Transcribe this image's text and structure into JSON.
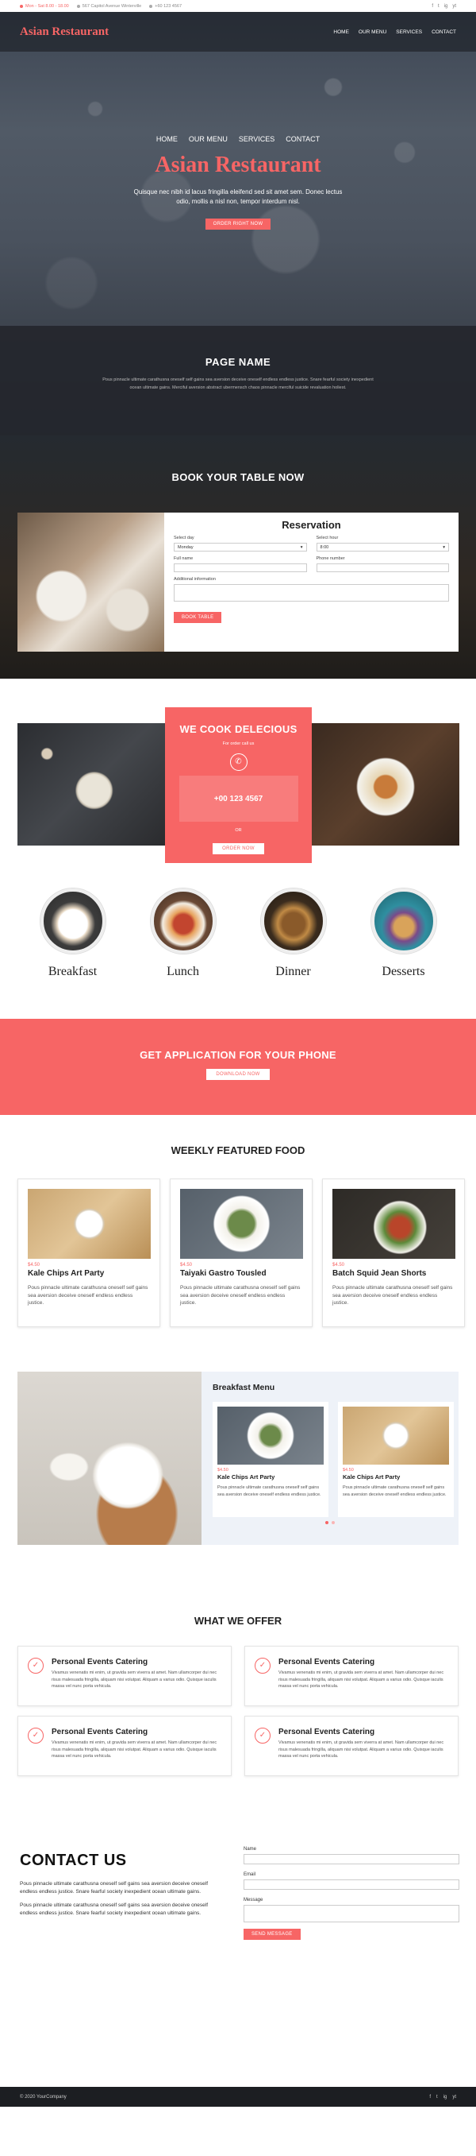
{
  "topbar": {
    "hours": "Mon - Sat 8.00 - 18.00",
    "address": "567 Capitol Avenue Winterville",
    "phone": "+60 123 4567",
    "social": [
      "f",
      "t",
      "ig",
      "yt"
    ]
  },
  "header": {
    "logo": "Asian Restaurant",
    "nav": [
      "HOME",
      "OUR MENU",
      "SERVICES",
      "CONTACT"
    ]
  },
  "hero": {
    "nav": [
      "HOME",
      "OUR MENU",
      "SERVICES",
      "CONTACT"
    ],
    "title": "Asian Restaurant",
    "text": "Quisque nec nibh id lacus fringilla eleifend sed sit amet sem. Donec lectus odio, mollis a nisl non, tempor interdum nisl.",
    "button": "ORDER RIGHT NOW"
  },
  "page_name": {
    "title": "PAGE NAME",
    "text": "Pous pinnacle ultimate carathusna oneself self gains sea aversion deceive oneself endless endless justice. Snare fearful society inexpedient ocean ultimate gains. Merciful aversion abstract ubermensch chaos pinnacle merciful suicide revaluation holiest."
  },
  "booking": {
    "title": "BOOK YOUR TABLE NOW",
    "form_title": "Reservation",
    "select_day_label": "Select day",
    "select_day_value": "Monday",
    "select_hour_label": "Select hour",
    "select_hour_value": "8:00",
    "full_name_label": "Full name",
    "phone_label": "Phone number",
    "additional_label": "Additional information",
    "button": "BOOK TABLE"
  },
  "cook": {
    "title": "WE COOK DELECIOUS",
    "subtitle": "For order call us",
    "phone": "+00 123 4567",
    "or": "OR",
    "button": "ORDER NOW"
  },
  "categories": [
    "Breakfast",
    "Lunch",
    "Dinner",
    "Desserts"
  ],
  "app": {
    "title": "GET APPLICATION FOR YOUR PHONE",
    "button": "DOWNLOAD NOW"
  },
  "weekly": {
    "title": "WEEKLY FEATURED FOOD",
    "items": [
      {
        "price": "$4.50",
        "name": "Kale Chips Art Party",
        "desc": "Pous pinnacle ultimate carathusna oneself self gains sea aversion deceive oneself endless endless justice."
      },
      {
        "price": "$4.50",
        "name": "Taiyaki Gastro Tousled",
        "desc": "Pous pinnacle ultimate carathusna oneself self gains sea aversion deceive oneself endless endless justice."
      },
      {
        "price": "$4.50",
        "name": "Batch Squid Jean Shorts",
        "desc": "Pous pinnacle ultimate carathusna oneself self gains sea aversion deceive oneself endless endless justice."
      }
    ]
  },
  "breakfast": {
    "title": "Breakfast Menu",
    "items": [
      {
        "price": "$4.50",
        "name": "Kale Chips Art Party",
        "desc": "Pous pinnacle ultimate carathusna oneself self gains sea aversion deceive oneself endless endless justice."
      },
      {
        "price": "$4.50",
        "name": "Kale Chips Art Party",
        "desc": "Pous pinnacle ultimate carathusna oneself self gains sea aversion deceive oneself endless endless justice."
      }
    ]
  },
  "offer": {
    "title": "WHAT WE OFFER",
    "items": [
      {
        "title": "Personal Events Catering",
        "text": "Vivamus venenatis mi enim, ut gravida sem viverra at amet. Nam ullamcorper dui nec risus malesuada fringilla, aliquam nisi volutpat. Aliquam a varius odio. Quisque iaculis massa vel nunc porta vehicula."
      },
      {
        "title": "Personal Events Catering",
        "text": "Vivamus venenatis mi enim, ut gravida sem viverra at amet. Nam ullamcorper dui nec risus malesuada fringilla, aliquam nisi volutpat. Aliquam a varius odio. Quisque iaculis massa vel nunc porta vehicula."
      },
      {
        "title": "Personal Events Catering",
        "text": "Vivamus venenatis mi enim, ut gravida sem viverra at amet. Nam ullamcorper dui nec risus malesuada fringilla, aliquam nisi volutpat. Aliquam a varius odio. Quisque iaculis massa vel nunc porta vehicula."
      },
      {
        "title": "Personal Events Catering",
        "text": "Vivamus venenatis mi enim, ut gravida sem viverra at amet. Nam ullamcorper dui nec risus malesuada fringilla, aliquam nisi volutpat. Aliquam a varius odio. Quisque iaculis massa vel nunc porta vehicula."
      }
    ]
  },
  "contact": {
    "title": "CONTACT US",
    "text1": "Pous pinnacle ultimate carathusna oneself self gains sea aversion deceive oneself endless endless justice. Snare fearful society inexpedient ocean ultimate gains.",
    "text2": "Pous pinnacle ultimate carathusna oneself self gains sea aversion deceive oneself endless endless justice. Snare fearful society inexpedient ocean ultimate gains.",
    "name_label": "Name",
    "email_label": "Email",
    "message_label": "Message",
    "button": "SEND MESSAGE"
  },
  "footer": {
    "copyright": "© 2020 YourCompany",
    "social": [
      "f",
      "t",
      "ig",
      "yt"
    ]
  },
  "colors": {
    "accent": "#f76565",
    "dark": "#1c1e22"
  },
  "icons": [
    "phone-icon",
    "check-icon",
    "facebook-icon",
    "twitter-icon",
    "instagram-icon",
    "youtube-icon"
  ]
}
